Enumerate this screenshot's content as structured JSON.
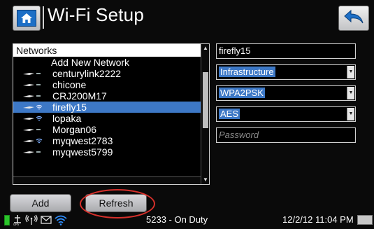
{
  "header": {
    "title": "Wi-Fi Setup",
    "home_icon": "home-icon",
    "back_icon": "back-arrow-icon"
  },
  "networks": {
    "header": "Networks",
    "items": [
      {
        "label": "Add New Network",
        "type": "add"
      },
      {
        "label": "centurylink2222",
        "type": "open"
      },
      {
        "label": "chicone",
        "type": "open"
      },
      {
        "label": "CRJ200M17",
        "type": "open"
      },
      {
        "label": "firefly15",
        "type": "secured",
        "selected": true
      },
      {
        "label": "lopaka",
        "type": "secured"
      },
      {
        "label": "Morgan06",
        "type": "open"
      },
      {
        "label": "myqwest2783",
        "type": "secured"
      },
      {
        "label": "myqwest5799",
        "type": "open"
      }
    ]
  },
  "form": {
    "ssid_value": "firefly15",
    "mode_value": "Infrastructure",
    "security_value": "WPA2PSK",
    "encryption_value": "AES",
    "password_placeholder": "Password"
  },
  "buttons": {
    "add_label": "Add",
    "refresh_label": "Refresh"
  },
  "status": {
    "unit_status": "5233 - On Duty",
    "datetime": "12/2/12 11:04 PM"
  },
  "colors": {
    "selection": "#3d78c6",
    "accent_blue": "#1d6fc6",
    "highlight_ring": "#d6302b",
    "battery_green": "#2bc42b"
  }
}
